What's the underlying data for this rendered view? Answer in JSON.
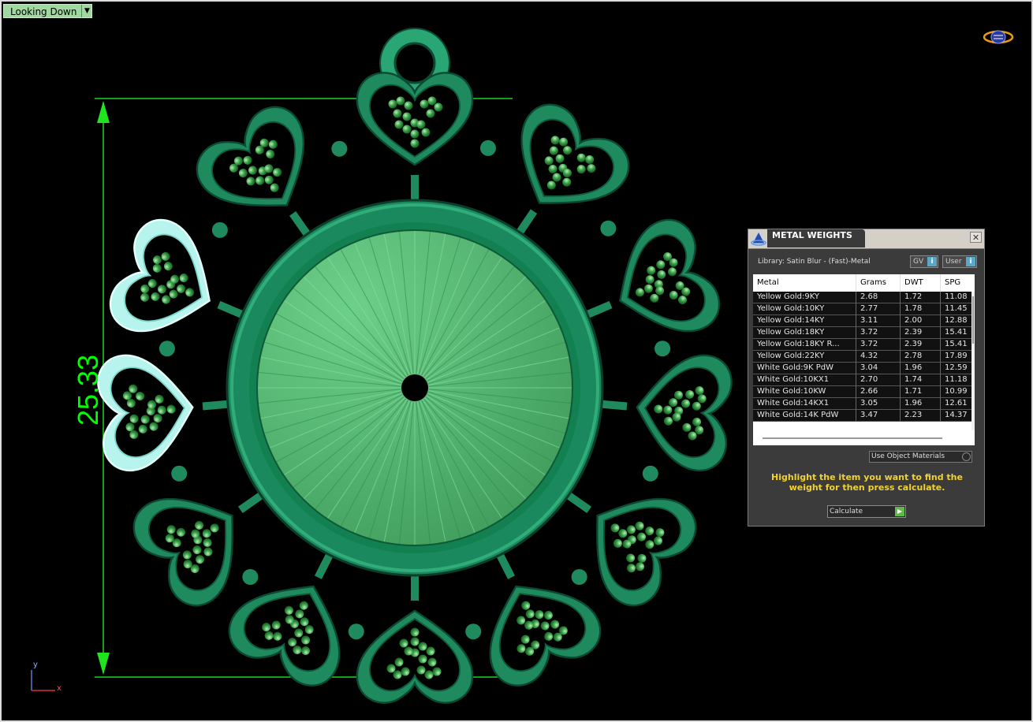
{
  "view_menu": {
    "label": "Looking Down"
  },
  "dimension": {
    "value": "25.33"
  },
  "axis": {
    "y": "y",
    "x": "x"
  },
  "colors": {
    "dimension": "#00ff00",
    "pendant": "#2b9b6a",
    "highlight": "#aef0e8",
    "instruction": "#f1d232"
  },
  "icons": {
    "logo": "orbit-logo-icon",
    "app": "pyramid-app-icon",
    "close": "close-icon"
  },
  "metal_weights": {
    "title": "METAL WEIGHTS",
    "library": "Library: Satin Blur - (Fast)-Metal",
    "gv_label": "GV",
    "user_label": "User",
    "columns": [
      "Metal",
      "Grams",
      "DWT",
      "SPG"
    ],
    "rows": [
      [
        "Yellow Gold:9KY",
        "2.68",
        "1.72",
        "11.08"
      ],
      [
        "Yellow Gold:10KY",
        "2.77",
        "1.78",
        "11.45"
      ],
      [
        "Yellow Gold:14KY",
        "3.11",
        "2.00",
        "12.88"
      ],
      [
        "Yellow Gold:18KY",
        "3.72",
        "2.39",
        "15.41"
      ],
      [
        "Yellow Gold:18KY R...",
        "3.72",
        "2.39",
        "15.41"
      ],
      [
        "Yellow Gold:22KY",
        "4.32",
        "2.78",
        "17.89"
      ],
      [
        "White Gold:9K PdW",
        "3.04",
        "1.96",
        "12.59"
      ],
      [
        "White Gold:10KX1",
        "2.70",
        "1.74",
        "11.18"
      ],
      [
        "White Gold:10KW",
        "2.66",
        "1.71",
        "10.99"
      ],
      [
        "White Gold:14KX1",
        "3.05",
        "1.96",
        "12.61"
      ],
      [
        "White Gold:14K PdW",
        "3.47",
        "2.23",
        "14.37"
      ]
    ],
    "materials_label": "Use Object Materials",
    "instruction": "Highlight the item you want to find the weight for then press calculate.",
    "calculate_label": "Calculate"
  }
}
